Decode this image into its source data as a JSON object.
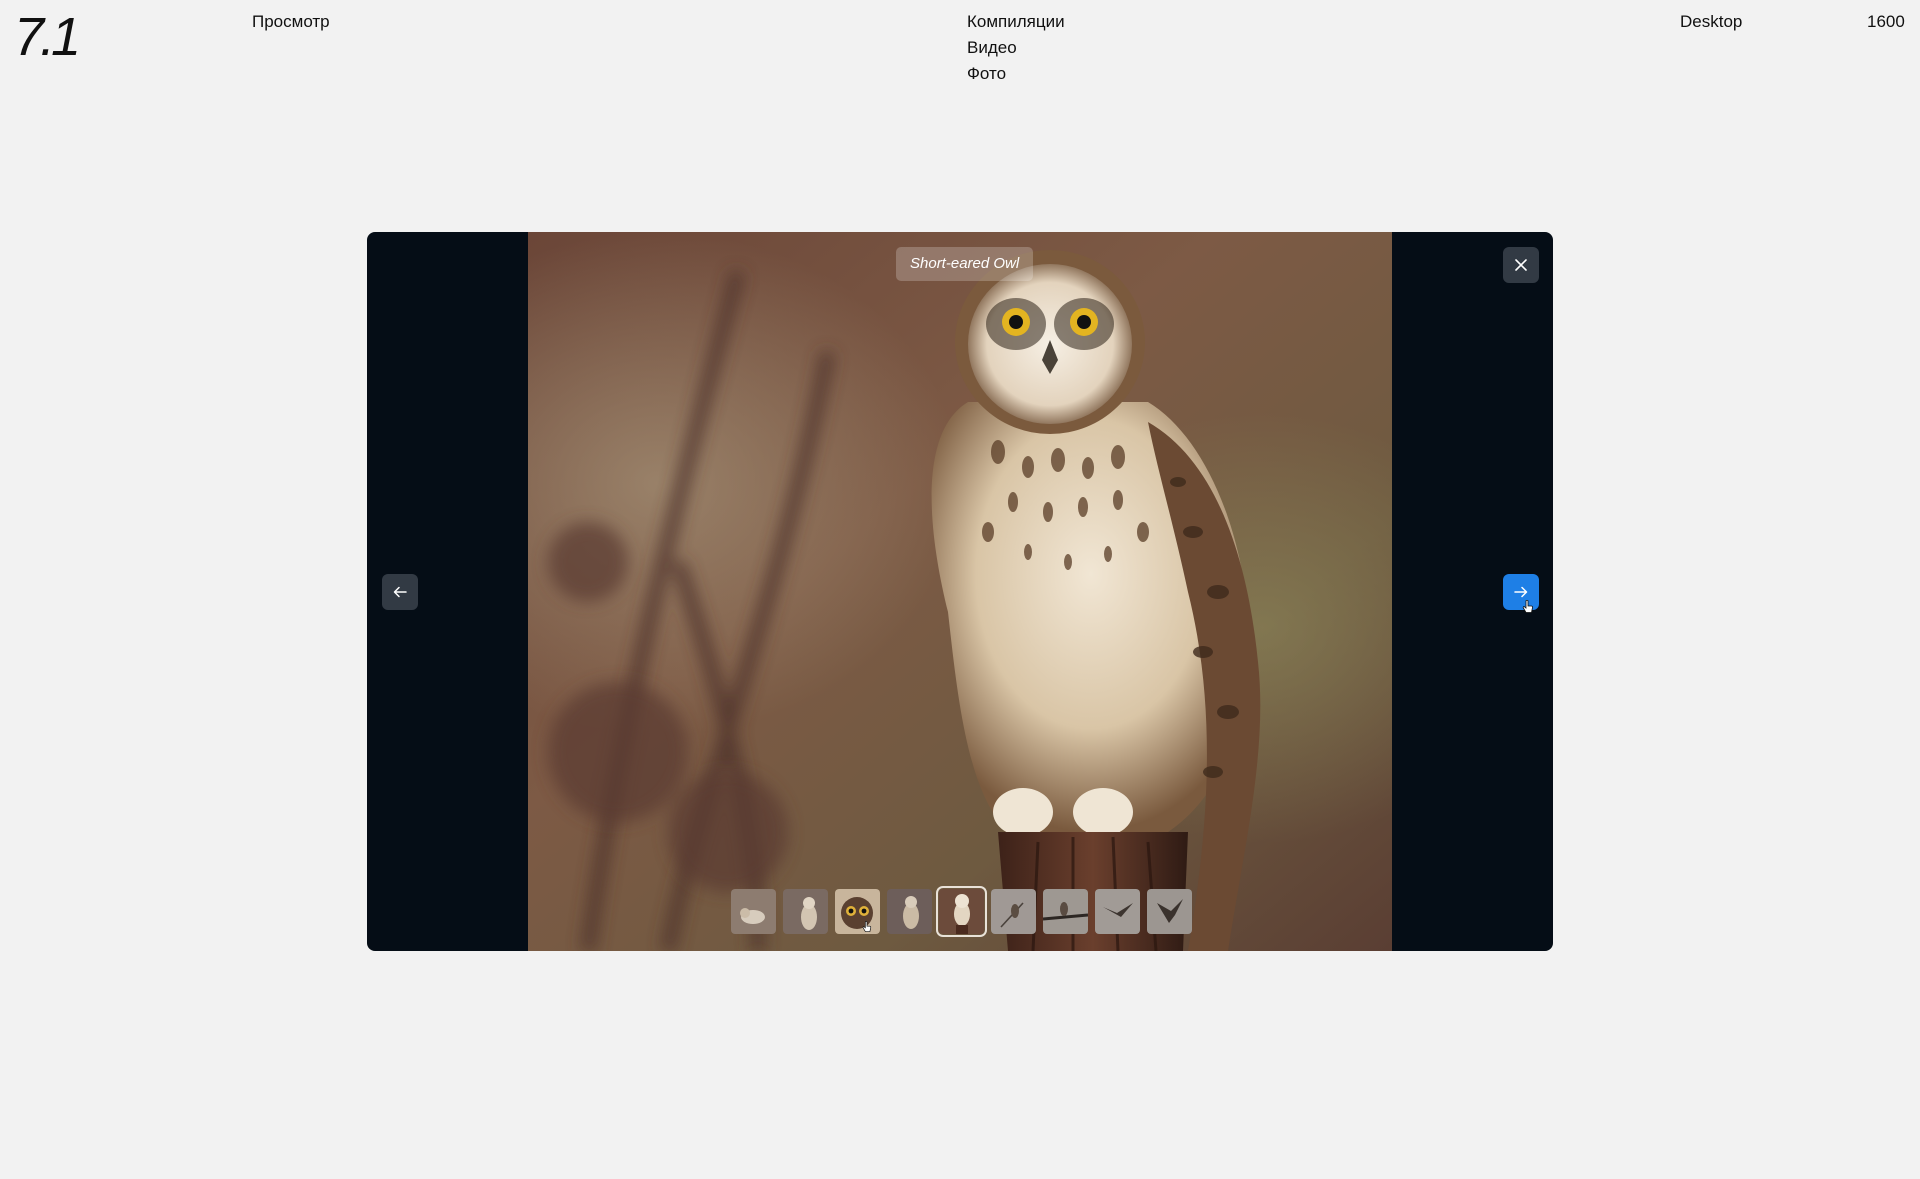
{
  "header": {
    "logo": "7.1",
    "view_label": "Просмотр",
    "menu": [
      "Компиляции",
      "Видео",
      "Фото"
    ],
    "device_label": "Desktop",
    "width_label": "1600"
  },
  "viewer": {
    "caption": "Short-eared Owl",
    "close_icon": "close-icon",
    "prev_icon": "arrow-left-icon",
    "next_icon": "arrow-right-icon",
    "accent_color": "#1e7fe6",
    "thumbnails": [
      {
        "subject": "owl-in-grass"
      },
      {
        "subject": "owl-perched"
      },
      {
        "subject": "owl-face-closeup"
      },
      {
        "subject": "owl-standing"
      },
      {
        "subject": "owl-on-post",
        "active": true
      },
      {
        "subject": "bird-on-branch"
      },
      {
        "subject": "bird-on-wire"
      },
      {
        "subject": "bird-in-flight"
      },
      {
        "subject": "bird-landing"
      }
    ]
  }
}
